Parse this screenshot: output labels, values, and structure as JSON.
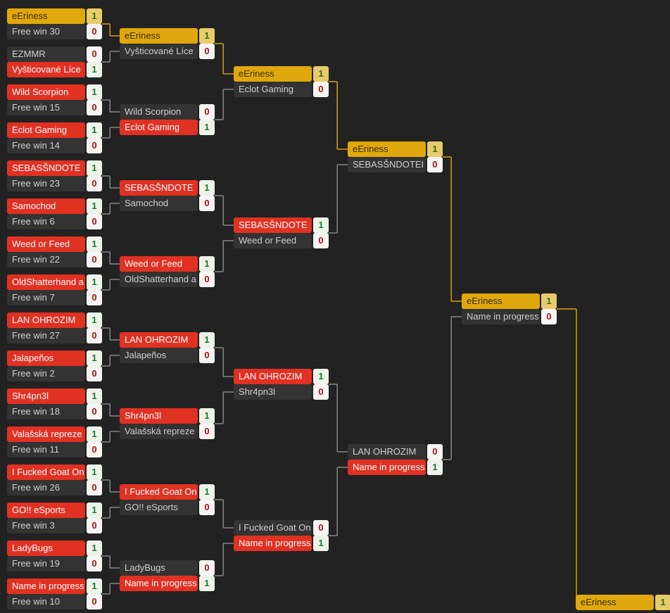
{
  "theme": {
    "background": "#222222",
    "win_name_bg": "#e03123",
    "lose_name_bg": "#333333",
    "champ_name_bg": "#e0a80c",
    "win_score_bg": "#eef3ea",
    "win_score_fg": "#167a28",
    "lose_score_bg": "#f7f4f4",
    "lose_score_fg": "#9c1414",
    "champ_score_bg": "#e8cb6a",
    "wire_gray": "#8d8d8d",
    "wire_gold": "#e0a80c"
  },
  "rounds": [
    {
      "name": "round-1",
      "matches": [
        {
          "top": {
            "label": "eEriness",
            "score": "1",
            "state": "champ"
          },
          "bottom": {
            "label": "Free win 30",
            "score": "0",
            "state": "lose"
          }
        },
        {
          "top": {
            "label": "EZMMR",
            "score": "0",
            "state": "lose"
          },
          "bottom": {
            "label": "Vyšticované Líce",
            "score": "1",
            "state": "win"
          }
        },
        {
          "top": {
            "label": "Wild Scorpion",
            "score": "1",
            "state": "win"
          },
          "bottom": {
            "label": "Free win 15",
            "score": "0",
            "state": "lose"
          }
        },
        {
          "top": {
            "label": "Eclot Gaming",
            "score": "1",
            "state": "win"
          },
          "bottom": {
            "label": "Free win 14",
            "score": "0",
            "state": "lose"
          }
        },
        {
          "top": {
            "label": "SEBASŠNDOTE",
            "score": "1",
            "state": "win"
          },
          "bottom": {
            "label": "Free win 23",
            "score": "0",
            "state": "lose"
          }
        },
        {
          "top": {
            "label": "Samochod",
            "score": "1",
            "state": "win"
          },
          "bottom": {
            "label": "Free win 6",
            "score": "0",
            "state": "lose"
          }
        },
        {
          "top": {
            "label": "Weed or Feed",
            "score": "1",
            "state": "win"
          },
          "bottom": {
            "label": "Free win 22",
            "score": "0",
            "state": "lose"
          }
        },
        {
          "top": {
            "label": "OldShatterhand a",
            "score": "1",
            "state": "win"
          },
          "bottom": {
            "label": "Free win 7",
            "score": "0",
            "state": "lose"
          }
        },
        {
          "top": {
            "label": "LAN OHROZIM",
            "score": "1",
            "state": "win"
          },
          "bottom": {
            "label": "Free win 27",
            "score": "0",
            "state": "lose"
          }
        },
        {
          "top": {
            "label": "Jalapeños",
            "score": "1",
            "state": "win"
          },
          "bottom": {
            "label": "Free win 2",
            "score": "0",
            "state": "lose"
          }
        },
        {
          "top": {
            "label": "Shr4pn3l",
            "score": "1",
            "state": "win"
          },
          "bottom": {
            "label": "Free win 18",
            "score": "0",
            "state": "lose"
          }
        },
        {
          "top": {
            "label": "Valašská repreze",
            "score": "1",
            "state": "win"
          },
          "bottom": {
            "label": "Free win 11",
            "score": "0",
            "state": "lose"
          }
        },
        {
          "top": {
            "label": "I Fucked Goat On",
            "score": "1",
            "state": "win"
          },
          "bottom": {
            "label": "Free win 26",
            "score": "0",
            "state": "lose"
          }
        },
        {
          "top": {
            "label": "GO!! eSports",
            "score": "1",
            "state": "win"
          },
          "bottom": {
            "label": "Free win 3",
            "score": "0",
            "state": "lose"
          }
        },
        {
          "top": {
            "label": "LadyBugs",
            "score": "1",
            "state": "win"
          },
          "bottom": {
            "label": "Free win 19",
            "score": "0",
            "state": "lose"
          }
        },
        {
          "top": {
            "label": "Name in progress",
            "score": "1",
            "state": "win"
          },
          "bottom": {
            "label": "Free win 10",
            "score": "0",
            "state": "lose"
          }
        }
      ]
    },
    {
      "name": "round-2",
      "matches": [
        {
          "top": {
            "label": "eEriness",
            "score": "1",
            "state": "champ"
          },
          "bottom": {
            "label": "Vyšticované Líce",
            "score": "0",
            "state": "lose"
          }
        },
        {
          "top": {
            "label": "Wild Scorpion",
            "score": "0",
            "state": "lose"
          },
          "bottom": {
            "label": "Eclot Gaming",
            "score": "1",
            "state": "win"
          }
        },
        {
          "top": {
            "label": "SEBASŠNDOTE",
            "score": "1",
            "state": "win"
          },
          "bottom": {
            "label": "Samochod",
            "score": "0",
            "state": "lose"
          }
        },
        {
          "top": {
            "label": "Weed or Feed",
            "score": "1",
            "state": "win"
          },
          "bottom": {
            "label": "OldShatterhand a",
            "score": "0",
            "state": "lose"
          }
        },
        {
          "top": {
            "label": "LAN OHROZIM",
            "score": "1",
            "state": "win"
          },
          "bottom": {
            "label": "Jalapeños",
            "score": "0",
            "state": "lose"
          }
        },
        {
          "top": {
            "label": "Shr4pn3l",
            "score": "1",
            "state": "win"
          },
          "bottom": {
            "label": "Valašská repreze",
            "score": "0",
            "state": "lose"
          }
        },
        {
          "top": {
            "label": "I Fucked Goat On",
            "score": "1",
            "state": "win"
          },
          "bottom": {
            "label": "GO!! eSports",
            "score": "0",
            "state": "lose"
          }
        },
        {
          "top": {
            "label": "LadyBugs",
            "score": "0",
            "state": "lose"
          },
          "bottom": {
            "label": "Name in progress",
            "score": "1",
            "state": "win"
          }
        }
      ]
    },
    {
      "name": "round-3",
      "matches": [
        {
          "top": {
            "label": "eEriness",
            "score": "1",
            "state": "champ"
          },
          "bottom": {
            "label": "Eclot Gaming",
            "score": "0",
            "state": "lose"
          }
        },
        {
          "top": {
            "label": "SEBASŠNDOTE",
            "score": "1",
            "state": "win"
          },
          "bottom": {
            "label": "Weed or Feed",
            "score": "0",
            "state": "lose"
          }
        },
        {
          "top": {
            "label": "LAN OHROZIM",
            "score": "1",
            "state": "win"
          },
          "bottom": {
            "label": "Shr4pn3l",
            "score": "0",
            "state": "lose"
          }
        },
        {
          "top": {
            "label": "I Fucked Goat On",
            "score": "0",
            "state": "lose"
          },
          "bottom": {
            "label": "Name in progress",
            "score": "1",
            "state": "win"
          }
        }
      ]
    },
    {
      "name": "semifinal",
      "matches": [
        {
          "top": {
            "label": "eEriness",
            "score": "1",
            "state": "champ"
          },
          "bottom": {
            "label": "SEBASŠNDOTEI",
            "score": "0",
            "state": "lose"
          }
        },
        {
          "top": {
            "label": "LAN OHROZIM",
            "score": "0",
            "state": "lose"
          },
          "bottom": {
            "label": "Name in progress",
            "score": "1",
            "state": "win"
          }
        }
      ]
    },
    {
      "name": "final",
      "matches": [
        {
          "top": {
            "label": "eEriness",
            "score": "1",
            "state": "champ"
          },
          "bottom": {
            "label": "Name in progress",
            "score": "0",
            "state": "lose"
          }
        }
      ]
    },
    {
      "name": "winner",
      "matches": [
        {
          "top": {
            "label": "eEriness",
            "score": "1",
            "state": "champ"
          }
        }
      ]
    }
  ]
}
